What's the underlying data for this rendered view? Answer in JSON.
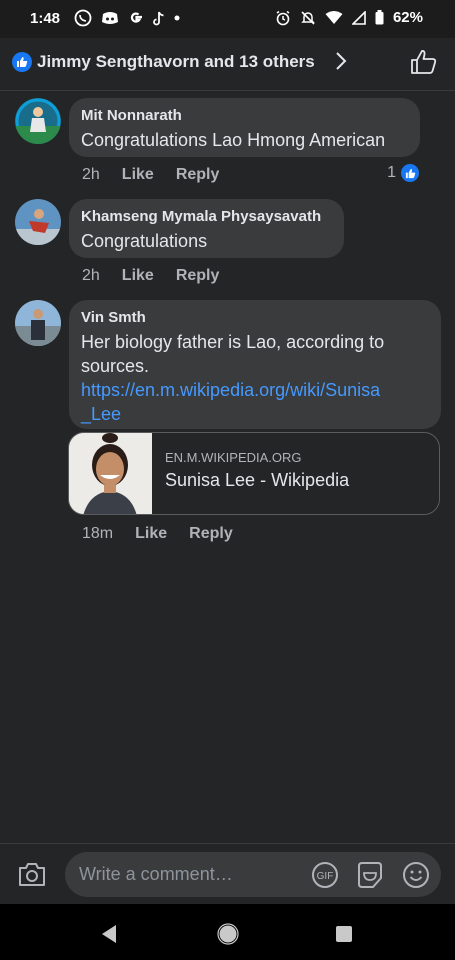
{
  "status_bar": {
    "time": "1:48",
    "battery": "62%"
  },
  "header": {
    "title": "Jimmy Sengthavorn and 13 others"
  },
  "comments": [
    {
      "author": "Mit Nonnarath",
      "text": "Congratulations Lao Hmong American",
      "time": "2h",
      "like": "Like",
      "reply": "Reply",
      "reactions": "1"
    },
    {
      "author": "Khamseng Mymala Physaysavath",
      "text": "Congratulations",
      "time": "2h",
      "like": "Like",
      "reply": "Reply"
    },
    {
      "author": "Vin Smth",
      "text": "Her biology father is Lao,  according to sources.",
      "link_line1": "https://en.m.wikipedia.org/wiki/Sunisa",
      "link_line2": "_Lee",
      "time": "18m",
      "like": "Like",
      "reply": "Reply",
      "preview": {
        "domain": "EN.M.WIKIPEDIA.ORG",
        "title": "Sunisa Lee - Wikipedia"
      }
    }
  ],
  "composer": {
    "placeholder": "Write a comment…",
    "gif_label": "GIF"
  },
  "colors": {
    "background": "#242526",
    "bubble": "#3a3b3c",
    "accent": "#1877f2",
    "link": "#4599ff"
  }
}
